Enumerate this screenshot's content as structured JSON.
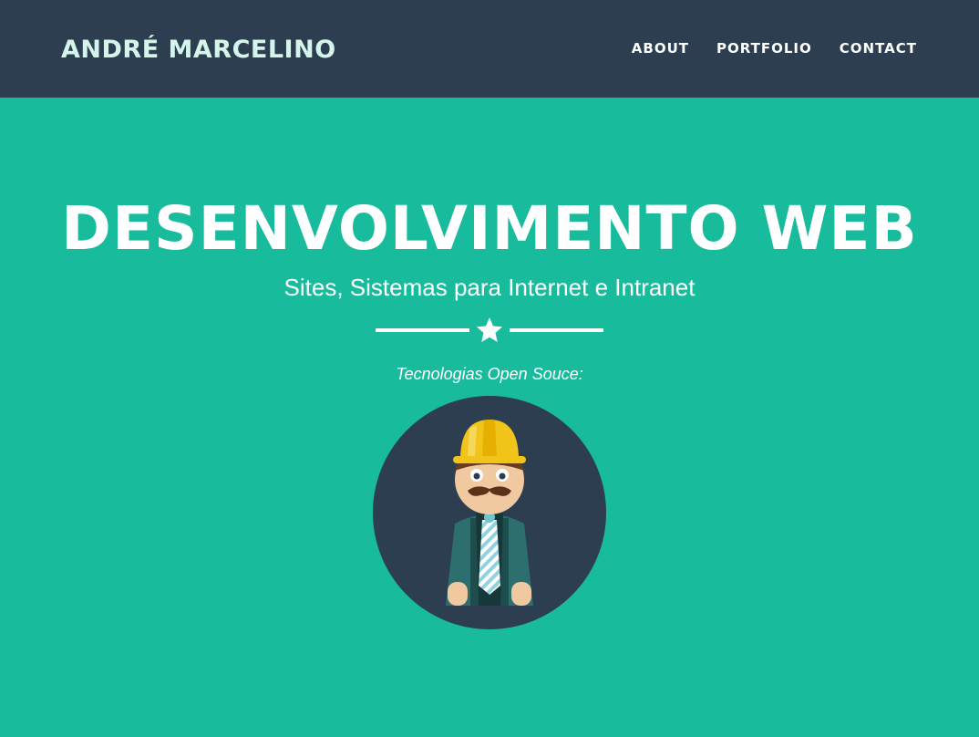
{
  "navbar": {
    "brand": "ANDRÉ MARCELINO",
    "links": [
      {
        "label": "ABOUT"
      },
      {
        "label": "PORTFOLIO"
      },
      {
        "label": "CONTACT"
      }
    ]
  },
  "hero": {
    "title": "DESENVOLVIMENTO WEB",
    "subtitle": "Sites, Sistemas para Internet e Intranet",
    "divider_icon": "star-icon",
    "tech_label": "Tecnologias Open Souce:",
    "avatar_icon": "developer-avatar-icon"
  },
  "colors": {
    "navbar_bg": "#2c3e50",
    "brand_text": "#d5f5ec",
    "hero_bg": "#18bc9c",
    "text": "#ffffff"
  }
}
